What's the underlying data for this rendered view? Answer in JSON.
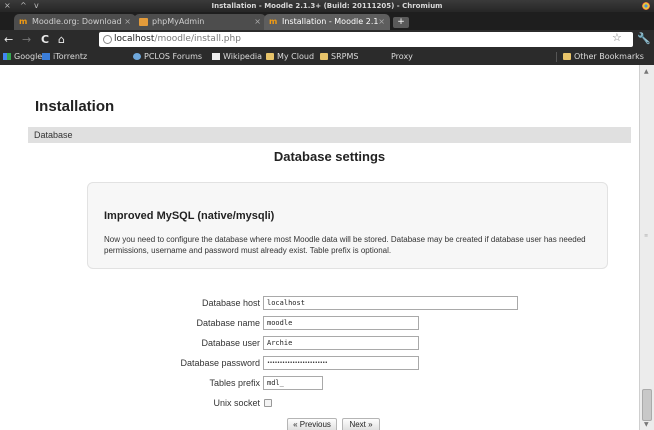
{
  "window": {
    "title": "Installation - Moodle 2.1.3+ (Build: 20111205) - Chromium",
    "controls": [
      "×",
      "^",
      "v"
    ]
  },
  "tabs": [
    {
      "label": "Moodle.org: Download",
      "favicon": "moodle-icon"
    },
    {
      "label": "phpMyAdmin",
      "favicon": "phpmyadmin-icon"
    },
    {
      "label": "Installation - Moodle 2.1",
      "favicon": "moodle-icon"
    }
  ],
  "toolbar": {
    "url_host": "localhost",
    "url_path": "/moodle/install.php"
  },
  "bookmarks": [
    {
      "label": "Google",
      "icon": "google-icon"
    },
    {
      "label": "iTorrentz",
      "icon": "torrentz-icon"
    },
    {
      "label": "PCLOS Forums",
      "icon": "pclos-icon"
    },
    {
      "label": "Wikipedia",
      "icon": "wikipedia-icon"
    },
    {
      "label": "My Cloud",
      "icon": "folder-icon"
    },
    {
      "label": "SRPMS",
      "icon": "folder-icon"
    },
    {
      "label": "Proxy",
      "icon": ""
    },
    {
      "label": "Other Bookmarks",
      "icon": "folder-icon"
    }
  ],
  "page": {
    "heading": "Installation",
    "navbar": "Database",
    "section_title": "Database settings",
    "info_title": "Improved MySQL (native/mysqli)",
    "info_text": "Now you need to configure the database where most Moodle data will be stored. Database may be created if database user has needed permissions, username and password must already exist. Table prefix is optional."
  },
  "form": {
    "host": {
      "label": "Database host",
      "value": "localhost"
    },
    "name": {
      "label": "Database name",
      "value": "moodle"
    },
    "user": {
      "label": "Database user",
      "value": "Archie"
    },
    "password": {
      "label": "Database password",
      "value": "••••••••••••••••••••••••"
    },
    "prefix": {
      "label": "Tables prefix",
      "value": "mdl_"
    },
    "socket": {
      "label": "Unix socket",
      "checked": false
    }
  },
  "buttons": {
    "previous": "« Previous",
    "next": "Next »"
  },
  "colors": {
    "chrome_dark": "#2b2b2b",
    "navbar_bg": "#e0e0e0",
    "infobox_bg": "#f7f7f7"
  }
}
